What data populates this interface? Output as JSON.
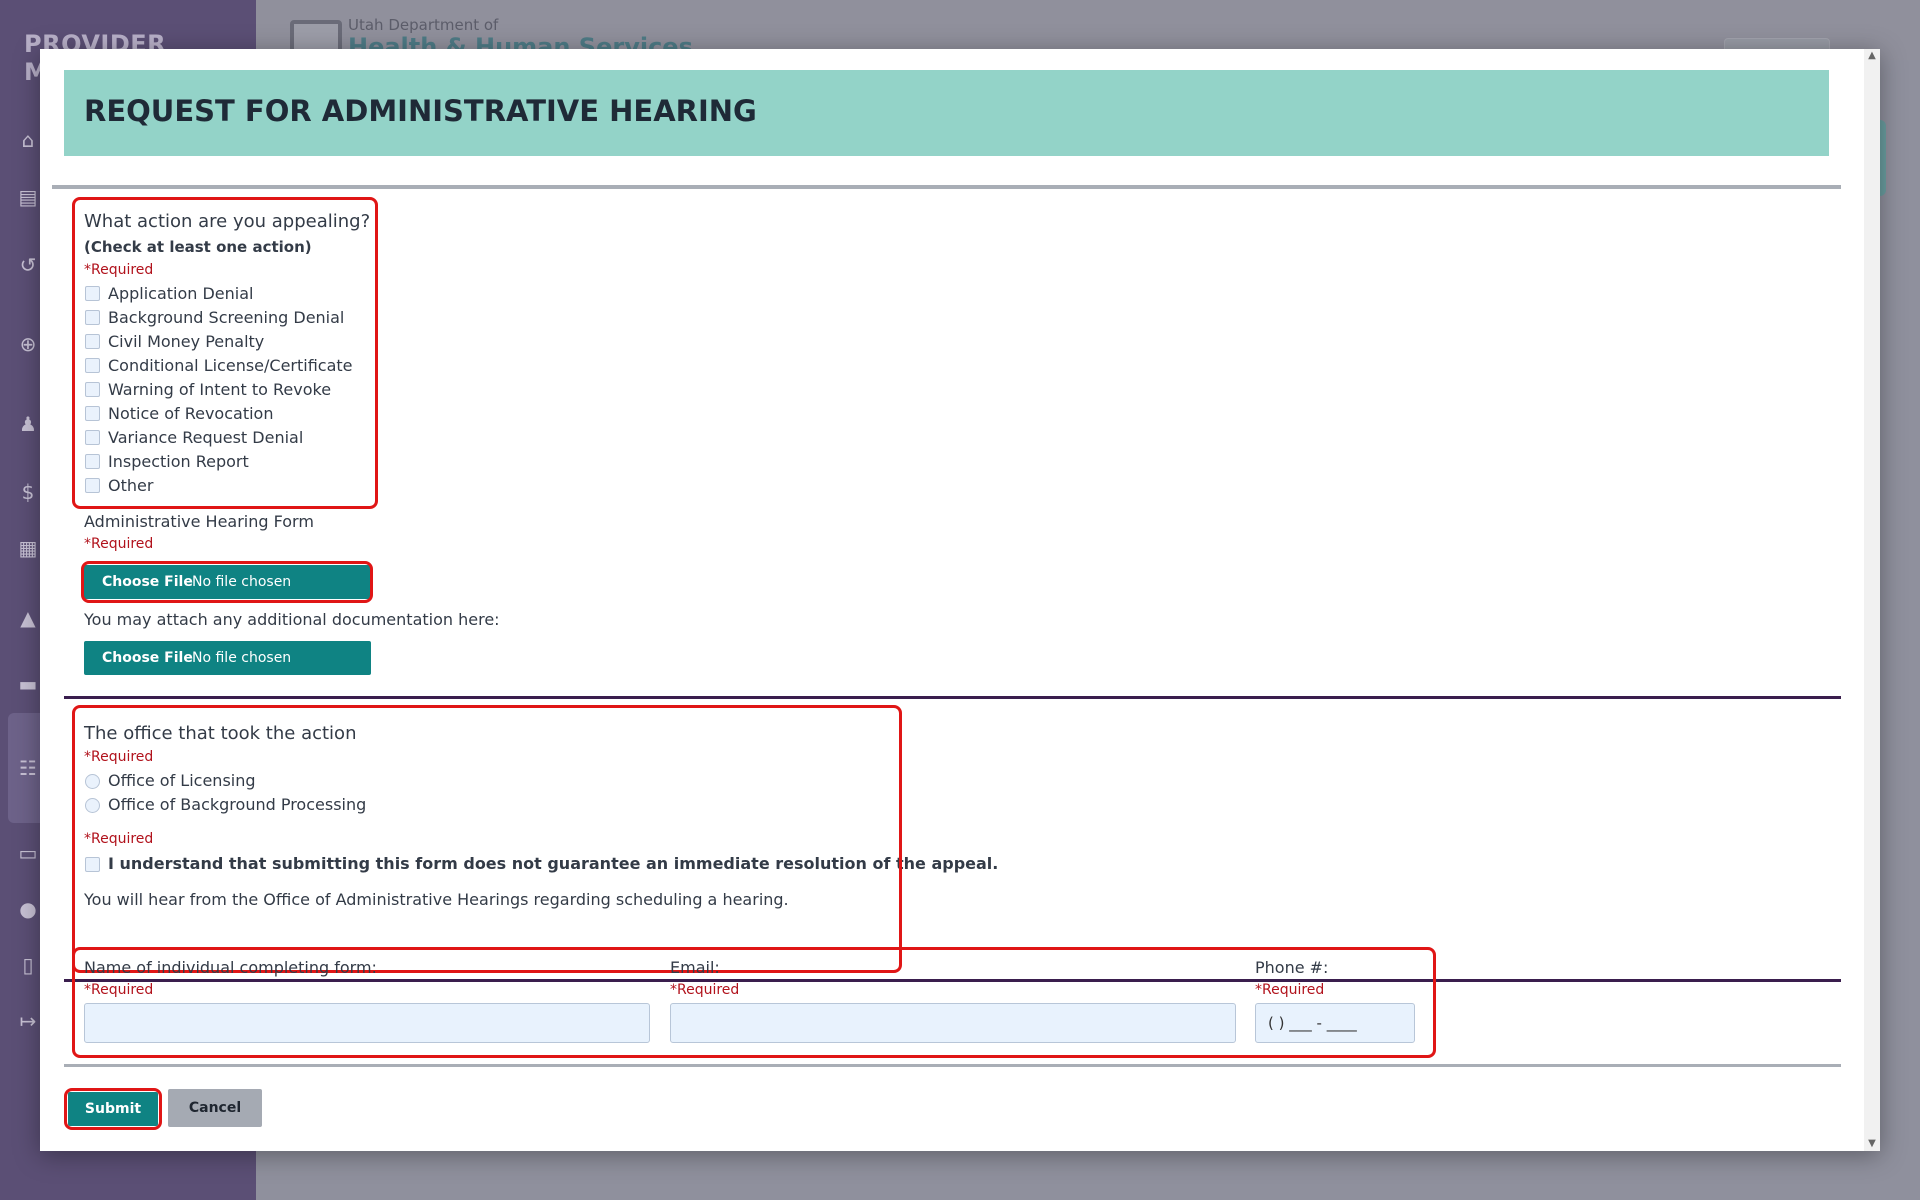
{
  "background": {
    "sidebar_title": "PROVIDER MENU",
    "org_small": "Utah Department of",
    "org_big": "Health & Human Services",
    "sidebar_icons": [
      "home-icon",
      "clipboard-icon",
      "history-icon",
      "plus-circle-icon",
      "user-gear-icon",
      "dollar-icon",
      "document-icon",
      "warning-icon",
      "folder-icon",
      "users-icon",
      "id-card-icon",
      "chat-icon",
      "file-icon",
      "logout-icon"
    ]
  },
  "modal": {
    "title": "REQUEST FOR ADMINISTRATIVE HEARING",
    "action_section": {
      "question": "What action are you appealing?",
      "hint": "(Check at least one action)",
      "required": "*Required",
      "options": [
        "Application Denial",
        "Background Screening Denial",
        "Civil Money Penalty",
        "Conditional License/Certificate",
        "Warning of Intent to Revoke",
        "Notice of Revocation",
        "Variance Request Denial",
        "Inspection Report",
        "Other"
      ]
    },
    "hearing_form": {
      "label": "Administrative Hearing Form",
      "required": "*Required",
      "button": "Choose File",
      "status": "No file chosen"
    },
    "additional_docs": {
      "label": "You may attach any additional documentation here:",
      "button": "Choose File",
      "status": "No file chosen"
    },
    "office_section": {
      "question": "The office that took the action",
      "required": "*Required",
      "options": [
        "Office of Licensing",
        "Office of Background Processing"
      ],
      "ack_required": "*Required",
      "ack_label": "I understand that submitting this form does not guarantee an immediate resolution of the appeal.",
      "note": "You will hear from the Office of Administrative Hearings regarding scheduling a hearing."
    },
    "contact_section": {
      "name_label": "Name of individual completing form:",
      "name_required": "*Required",
      "name_value": "",
      "email_label": "Email:",
      "email_required": "*Required",
      "email_value": "",
      "phone_label": "Phone #:",
      "phone_required": "*Required",
      "phone_value": "(   ) ___ - ____"
    },
    "buttons": {
      "submit": "Submit",
      "cancel": "Cancel"
    }
  },
  "colors": {
    "banner": "#93d3c8",
    "primary_button": "#0f8383",
    "required_text": "#b1121c",
    "highlight": "#e01616"
  }
}
